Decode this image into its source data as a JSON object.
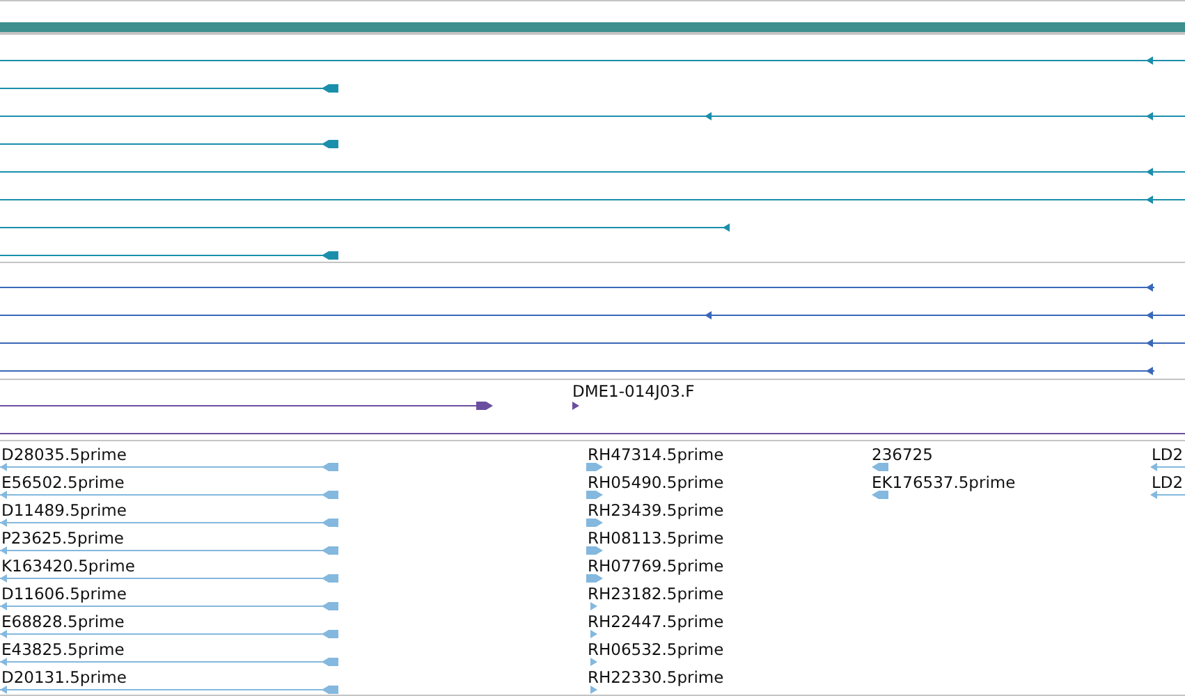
{
  "header": {
    "color": "#3f8f8f"
  },
  "tracks": [
    {
      "kind": "lines",
      "color": "#1a8fab"
    },
    {
      "kind": "lines",
      "color": "#3a68b8"
    },
    {
      "kind": "single",
      "color": "#6a4fa0",
      "labels": [
        "DME1-014J03.F"
      ]
    },
    {
      "kind": "columns",
      "color": "#84b8de",
      "columns": [
        [
          "D28035.5prime",
          "E56502.5prime",
          "D11489.5prime",
          "P23625.5prime",
          "K163420.5prime",
          "D11606.5prime",
          "E68828.5prime",
          "E43825.5prime",
          "D20131.5prime"
        ],
        [
          "RH47314.5prime",
          "RH05490.5prime",
          "RH23439.5prime",
          "RH08113.5prime",
          "RH07769.5prime",
          "RH23182.5prime",
          "RH22447.5prime",
          "RH06532.5prime",
          "RH22330.5prime"
        ],
        [
          "236725",
          "EK176537.5prime"
        ],
        [
          "LD2",
          "LD2"
        ]
      ]
    }
  ]
}
